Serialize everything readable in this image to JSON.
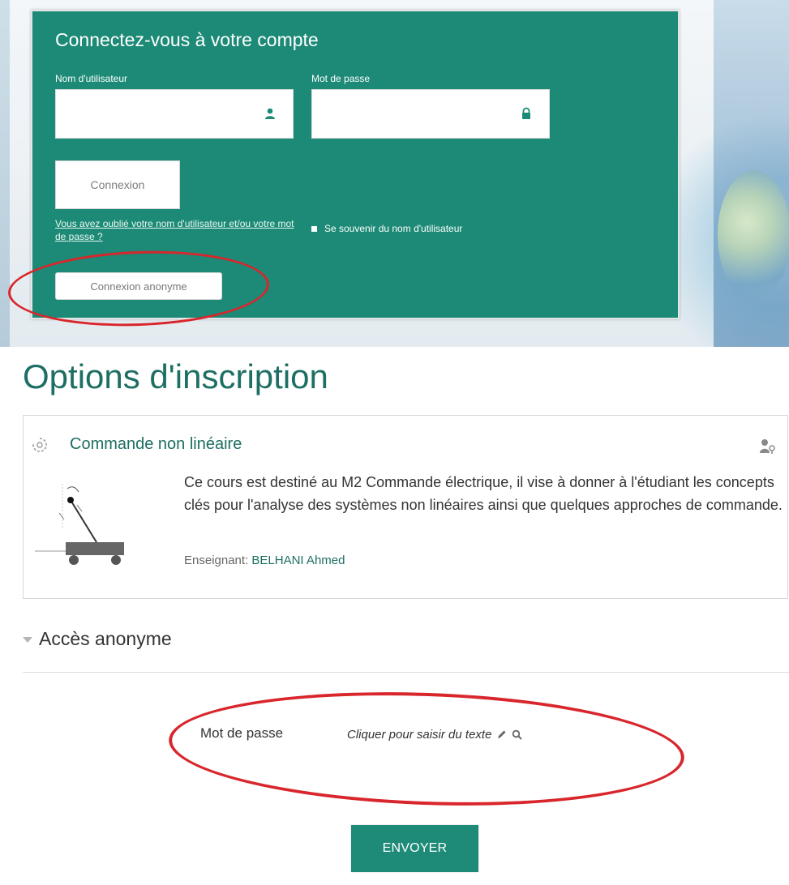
{
  "login": {
    "title": "Connectez-vous à votre compte",
    "username_label": "Nom d'utilisateur",
    "password_label": "Mot de passe",
    "username_value": "",
    "password_value": "",
    "login_button": "Connexion",
    "forgot_link": "Vous avez oublié votre nom d'utilisateur et/ou votre mot de passe ?",
    "remember_label": "Se souvenir du nom d'utilisateur",
    "anonymous_button": "Connexion anonyme"
  },
  "enrol": {
    "heading": "Options d'inscription",
    "course_name": "Commande non linéaire",
    "course_summary": "Ce cours est destiné au M2 Commande électrique, il vise à donner à l'étudiant les concepts clés pour l'analyse des systèmes non linéaires ainsi que quelques approches de commande.",
    "teacher_label": "Enseignant:",
    "teacher_name": "BELHANI Ahmed",
    "section_title": "Accès anonyme",
    "password_label": "Mot de passe",
    "password_placeholder": "Cliquer pour saisir du texte",
    "submit_button": "ENVOYER"
  },
  "colors": {
    "login_card": "#1c8a76",
    "heading": "#1d6e63",
    "submit_button": "#1e8a78",
    "annotation": "#d8262c"
  },
  "icons": {
    "username": "user-icon",
    "password": "lock-icon",
    "course": "course-icon",
    "guest": "guest-access-icon",
    "edit": "pencil-icon",
    "search": "search-icon"
  }
}
